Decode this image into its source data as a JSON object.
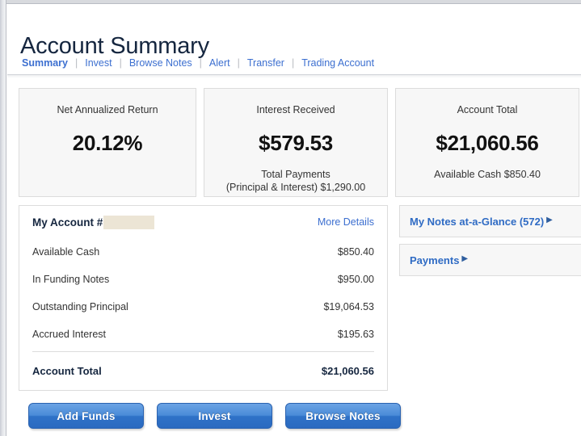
{
  "header": {
    "title": "Account Summary"
  },
  "nav": {
    "separator": "|",
    "items": [
      {
        "label": "Summary",
        "active": true
      },
      {
        "label": "Invest",
        "active": false
      },
      {
        "label": "Browse Notes",
        "active": false
      },
      {
        "label": "Alert",
        "active": false
      },
      {
        "label": "Transfer",
        "active": false
      },
      {
        "label": "Trading Account",
        "active": false
      }
    ]
  },
  "metric_cards": [
    {
      "label": "Net Annualized Return",
      "value": "20.12%",
      "sub_line1": "",
      "sub_line2": ""
    },
    {
      "label": "Interest Received",
      "value": "$579.53",
      "sub_line1": "Total Payments",
      "sub_line2": "(Principal & Interest) $1,290.00"
    },
    {
      "label": "Account Total",
      "value": "$21,060.56",
      "sub_line1": "Available Cash $850.40",
      "sub_line2": ""
    }
  ],
  "account_panel": {
    "title": "My Account #",
    "account_number_redacted": true,
    "more_details_label": "More Details",
    "rows": [
      {
        "label": "Available Cash",
        "value": "$850.40"
      },
      {
        "label": "In Funding Notes",
        "value": "$950.00"
      },
      {
        "label": "Outstanding Principal",
        "value": "$19,064.53"
      },
      {
        "label": "Accrued Interest",
        "value": "$195.63"
      }
    ],
    "total": {
      "label": "Account Total",
      "value": "$21,060.56"
    }
  },
  "side_panels": [
    {
      "label": "My Notes at-a-Glance (572)",
      "arrow": "▶"
    },
    {
      "label": "Payments",
      "arrow": "▶"
    }
  ],
  "buttons": [
    {
      "label": "Add Funds"
    },
    {
      "label": "Invest"
    },
    {
      "label": "Browse Notes"
    }
  ],
  "colors": {
    "link_blue": "#3c6fd0",
    "title_navy": "#15263f",
    "button_blue": "#2f72c8",
    "card_bg": "#f7f7f7",
    "border_gray": "#dcdcdc",
    "redaction": "#ece5d5"
  }
}
